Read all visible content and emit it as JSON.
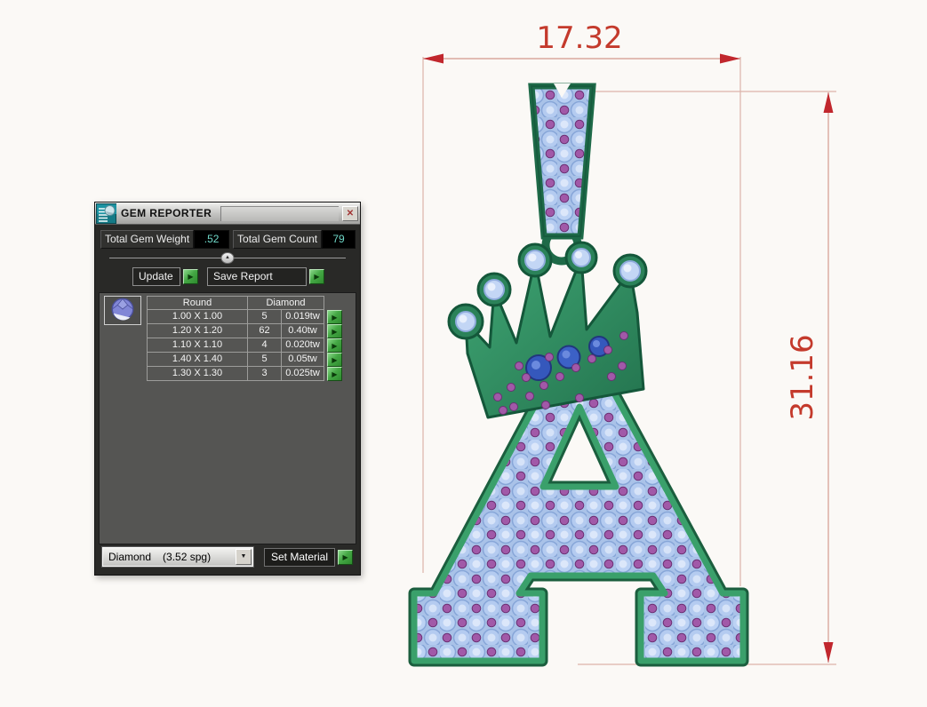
{
  "window": {
    "title": "GEM REPORTER"
  },
  "icons": {
    "close": "✕",
    "run": "▶",
    "dropdown": "▼",
    "collapse": "▲"
  },
  "totals": {
    "weight_label": "Total Gem Weight",
    "weight_value": ".52",
    "count_label": "Total Gem Count",
    "count_value": "79"
  },
  "actions": {
    "update": "Update",
    "save_report": "Save Report",
    "set_material": "Set Material"
  },
  "gem_table": {
    "shape_header": "Round",
    "type_header": "Diamond",
    "rows": [
      {
        "size": "1.00 X 1.00",
        "count": "5",
        "weight": "0.019tw"
      },
      {
        "size": "1.20 X 1.20",
        "count": "62",
        "weight": "0.40tw"
      },
      {
        "size": "1.10 X 1.10",
        "count": "4",
        "weight": "0.020tw"
      },
      {
        "size": "1.40 X 1.40",
        "count": "5",
        "weight": "0.05tw"
      },
      {
        "size": "1.30 X 1.30",
        "count": "3",
        "weight": "0.025tw"
      }
    ]
  },
  "material": {
    "selected": "Diamond",
    "density": "(3.52 spg)"
  },
  "dimensions": {
    "width": "17.32",
    "height": "31.16"
  },
  "colors": {
    "dimension_text": "#c43a2c",
    "dimension_arrow": "#c1272d",
    "dimension_line": "#dcafa6",
    "metal_green": "#349367",
    "gem_blue": "#bcd2f4",
    "bead_purple": "#a159a8",
    "sapphire_blue": "#3558bc",
    "value_teal": "#6fd8c8",
    "run_button_green": "#3fa33f"
  }
}
